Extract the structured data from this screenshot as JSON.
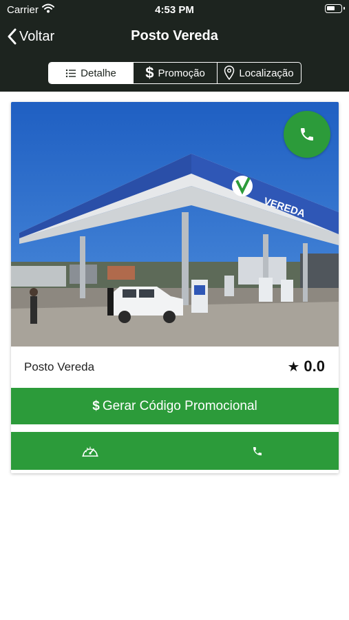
{
  "status_bar": {
    "carrier": "Carrier",
    "time": "4:53 PM"
  },
  "nav": {
    "back_label": "Voltar",
    "title": "Posto Vereda"
  },
  "tabs": [
    {
      "label": "Detalhe",
      "icon": "list-icon",
      "active": true
    },
    {
      "label": "Promoção",
      "icon": "dollar-icon",
      "active": false
    },
    {
      "label": "Localização",
      "icon": "location-pin-icon",
      "active": false
    }
  ],
  "tab_dollar_symbol": "$",
  "station": {
    "name": "Posto Vereda",
    "rating": "0.0",
    "star": "★",
    "brand_sign": "VEREDA",
    "promo_button": {
      "symbol": "$",
      "label": "Gerar Código Promocional"
    }
  },
  "colors": {
    "header_bg": "#1d241f",
    "accent_green": "#2c9b3a",
    "sky": "#1f5fc2"
  }
}
